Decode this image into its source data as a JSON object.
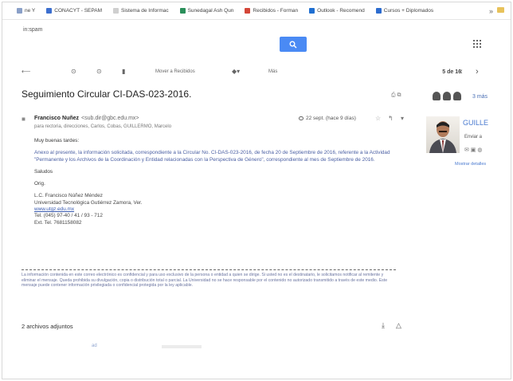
{
  "bookmarks": [
    {
      "label": "ne Y",
      "color": "#8aa0c8"
    },
    {
      "label": "CONACYT - SEPAM",
      "color": "#3c6fcf"
    },
    {
      "label": "Sistema de Informac",
      "color": "#cfcfcf"
    },
    {
      "label": "Sunedagal Ash Qun",
      "color": "#2a8f5a"
    },
    {
      "label": "Recibidos - Forman",
      "color": "#d44638"
    },
    {
      "label": "Outlook - Recomend",
      "color": "#1f6fd1"
    },
    {
      "label": "Cursos + Diplomados",
      "color": "#2c6ccf"
    }
  ],
  "bookmarks_more": "»",
  "search": {
    "query": "in:spam",
    "button_icon": "search-icon"
  },
  "toolbar": {
    "move_label": "Mover a Recibidos",
    "more_label": "Más",
    "pagination": "5 de 16"
  },
  "subject": "Seguimiento Circular CI-DAS-023-2016.",
  "more_people_label": "3 más",
  "sender": {
    "name": "Francisco Nuñez",
    "email": "<sub.dir@gbc.edu.mx>",
    "recipients": "para rectoria, direcciones, Carlos, Cobas, GUILLERMO, Marcelo",
    "meta": "22 sept. (hace 9 días)"
  },
  "body": {
    "greeting": "Muy buenas tardes:",
    "paragraph": "Anexo al presente, la información solicitada, correspondiente a la Circular No. CI-DAS-023-2016, de fecha 20 de Septiembre de 2016, referente a la Actividad \"Permanente y los Archivos de la Coordinación y Entidad relacionadas con la Perspectiva de Género\", correspondiente al mes de Septiembre de 2016.",
    "closing1": "Saludos",
    "closing2": "Orig.",
    "sig_lines": [
      "L.C. Francisco Núñez Méndez",
      "Universidad Tecnológica Gutiérrez Zamora, Ver.",
      "www.utgz.edu.mx",
      "Tel. (045) 97-40 / 41 / 93 - 712",
      "Ext. Tel. 7681158082"
    ],
    "sig_link_index": 2,
    "disclaimer": "La información contenida en este correo electrónico es confidencial y para uso exclusivo de la persona o entidad a quien se dirige. Si usted no es el destinatario, le solicitamos notificar al remitente y eliminar el mensaje. Queda prohibida su divulgación, copia o distribución total o parcial. La Universidad no se hace responsable por el contenido no autorizado transmitido a través de este medio. Este mensaje puede contener información privilegiada o confidencial protegida por la ley aplicable."
  },
  "attachments": {
    "label": "2 archivos adjuntos",
    "blur_label": "ad"
  },
  "profile": {
    "name": "GUILLE",
    "sub": "Enviar a",
    "link": "Mostrar detalles"
  }
}
